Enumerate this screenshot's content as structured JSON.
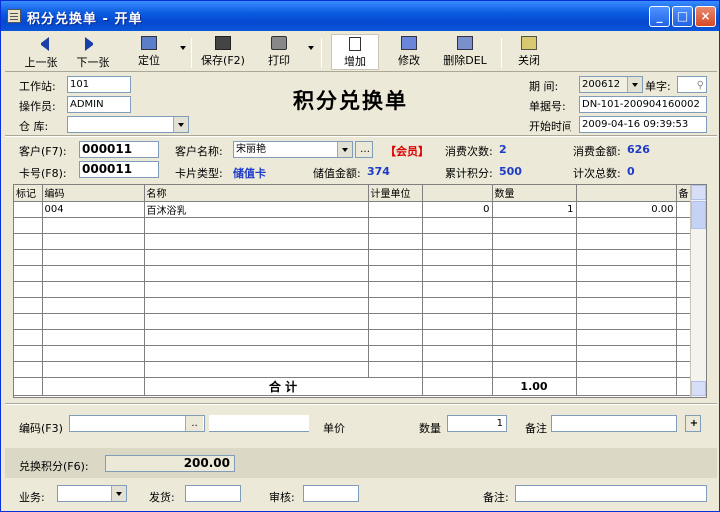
{
  "window": {
    "title": "积分兑换单 - 开单"
  },
  "toolbar": {
    "prev": "上一张",
    "next": "下一张",
    "locate": "定位",
    "save": "保存(F2)",
    "print": "打印",
    "add": "增加",
    "edit": "修改",
    "delete": "删除DEL",
    "close": "关闭"
  },
  "header": {
    "title": "积分兑换单",
    "terminal_label": "工作站:",
    "terminal_value": "101",
    "operator_label": "操作员:",
    "operator_value": "ADMIN",
    "warehouse_label": "仓   库:",
    "warehouse_value": "",
    "period_label": "期   间:",
    "period_value": "200612",
    "doc_label": "单字:",
    "doc_value": "",
    "docno_label": "单据号:",
    "docno_value": "DN-101-200904160002",
    "time_label": "开始时间:",
    "time_value": "2009-04-16 09:39:53"
  },
  "customer": {
    "cust_label": "客户(F7):",
    "cust_value": "000011",
    "name_label": "客户名称:",
    "name_value": "宋丽艳",
    "member_badge": "【会员】",
    "visits_label": "消费次数:",
    "visits_value": "2",
    "amount_label": "消费金额:",
    "amount_value": "626",
    "card_label": "卡号(F8):",
    "card_value": "000011",
    "cardtype_label": "卡片类型:",
    "cardtype_value": "储值卡",
    "stored_label": "储值金额:",
    "stored_value": "374",
    "points_label": "累计积分:",
    "points_value": "500",
    "count_label": "计次总数:",
    "count_value": "0"
  },
  "grid": {
    "headers": [
      "标记",
      "编码",
      "名称",
      "计量单位",
      "",
      "数量",
      "",
      "备"
    ],
    "rows": [
      {
        "mark": "",
        "code": "004",
        "name": "百沐浴乳",
        "unit": "",
        "c5": "0",
        "qty": "1",
        "c7": "0.00"
      }
    ],
    "total_label": "合       计",
    "total_value": "1.00"
  },
  "entry": {
    "code_label": "编码(F3)",
    "code_value": "",
    "price_label": "单价",
    "qty_label": "数量",
    "qty_value": "1",
    "note_label": "备注"
  },
  "exchange": {
    "points_label": "兑换积分(F6):",
    "points_value": "200.00"
  },
  "footer": {
    "business_label": "业务:",
    "ship_label": "发货:",
    "audit_label": "审核:",
    "remark_label": "备注:"
  }
}
